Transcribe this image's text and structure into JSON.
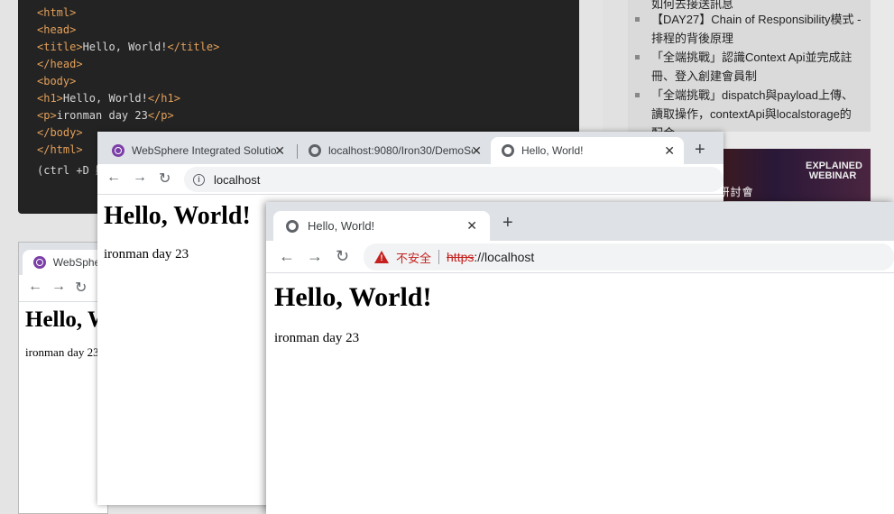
{
  "code": {
    "lines": [
      {
        "open": "<html>",
        "text": "",
        "close": ""
      },
      {
        "open": "<head>",
        "text": "",
        "close": ""
      },
      {
        "open": "<title>",
        "text": "Hello, World!",
        "close": "</title>"
      },
      {
        "open": "</head>",
        "text": "",
        "close": ""
      },
      {
        "open": "<body>",
        "text": "",
        "close": ""
      },
      {
        "open": "<h1>",
        "text": "Hello, World!",
        "close": "</h1>"
      },
      {
        "open": "<p>",
        "text": "ironman day 23",
        "close": "</p>"
      },
      {
        "open": "</body>",
        "text": "",
        "close": ""
      },
      {
        "open": "</html>",
        "text": "",
        "close": ""
      }
    ],
    "footer": "(ctrl +D 顯"
  },
  "sidebar": {
    "partial_top": "如何去接送訊息",
    "items": [
      "【DAY27】Chain of Responsibility模式 - 排程的背後原理",
      "「全端挑戰」認識Context Api並完成註冊、登入創建會員制",
      "「全端挑戰」dispatch與payload上傳、讀取操作，contextApi與localstorage的配合"
    ]
  },
  "banner": {
    "text": "ED最新系列線上研討會",
    "logo": "EXPLAINED WEBINAR"
  },
  "window_back": {
    "tab_title": "WebSphere",
    "heading": "Hello, W",
    "paragraph": "ironman day 23"
  },
  "window_mid": {
    "tabs": [
      {
        "title": "WebSphere Integrated Solution",
        "icon": "websphere-icon"
      },
      {
        "title": "localhost:9080/Iron30/DemoSe",
        "icon": "globe-icon"
      },
      {
        "title": "Hello, World!",
        "icon": "globe-icon"
      }
    ],
    "close_glyph": "✕",
    "new_tab_glyph": "+",
    "url": "localhost",
    "heading": "Hello, World!",
    "paragraph": "ironman day 23"
  },
  "window_front": {
    "tab_title": "Hello, World!",
    "close_glyph": "✕",
    "new_tab_glyph": "+",
    "security_label": "不安全",
    "url_scheme": "https",
    "url_rest": "://localhost",
    "heading": "Hello, World!",
    "paragraph": "ironman day 23"
  },
  "nav": {
    "back": "←",
    "forward": "→",
    "reload": "↻"
  },
  "colors": {
    "code_bg": "#232323",
    "tag": "#e3a05a",
    "insecure": "#c5221f",
    "tabstrip": "#dee1e6"
  }
}
